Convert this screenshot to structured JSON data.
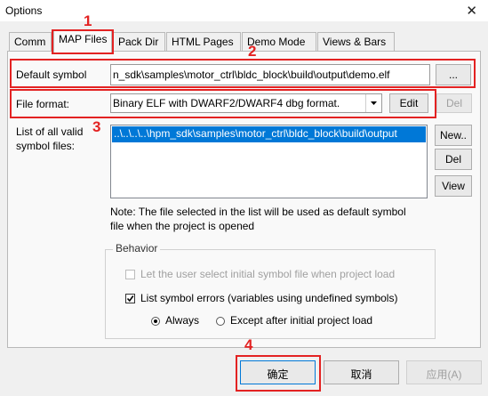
{
  "window": {
    "title": "Options",
    "close_glyph": "✕"
  },
  "tabs": [
    {
      "label": "Comm"
    },
    {
      "label": "MAP Files"
    },
    {
      "label": "Pack Dir"
    },
    {
      "label": "HTML Pages"
    },
    {
      "label": "Demo Mode"
    },
    {
      "label": "Views & Bars"
    }
  ],
  "default_symbol": {
    "label": "Default symbol",
    "value": "n_sdk\\samples\\motor_ctrl\\bldc_block\\build\\output\\demo.elf",
    "browse_label": "..."
  },
  "file_format": {
    "label": "File format:",
    "value": "Binary ELF with DWARF2/DWARF4 dbg format.",
    "edit_label": "Edit",
    "del_label": "Del"
  },
  "symbol_list": {
    "label_line1": "List of all valid",
    "label_line2": "symbol files:",
    "items": [
      "..\\..\\..\\..\\hpm_sdk\\samples\\motor_ctrl\\bldc_block\\build\\output"
    ],
    "new_label": "New..",
    "del_label": "Del",
    "view_label": "View"
  },
  "note": {
    "line1": "Note: The file selected in the list will be used as default symbol",
    "line2": "file when the project is opened"
  },
  "behavior": {
    "title": "Behavior",
    "let_user_select": "Let the user select initial symbol file when project load",
    "list_symbol_errors": "List symbol errors (variables using undefined symbols)",
    "always": "Always",
    "except_after": "Except after initial project load"
  },
  "footer": {
    "ok": "确定",
    "cancel": "取消",
    "apply": "应用(A)"
  },
  "annotations": {
    "n1": "1",
    "n2": "2",
    "n3": "3",
    "n4": "4"
  },
  "colors": {
    "highlight": "#e32222",
    "selection": "#0078d7"
  },
  "icons": {
    "dropdown": "arrow-down-icon",
    "checkmark": "checkmark-icon",
    "close": "close-icon"
  }
}
